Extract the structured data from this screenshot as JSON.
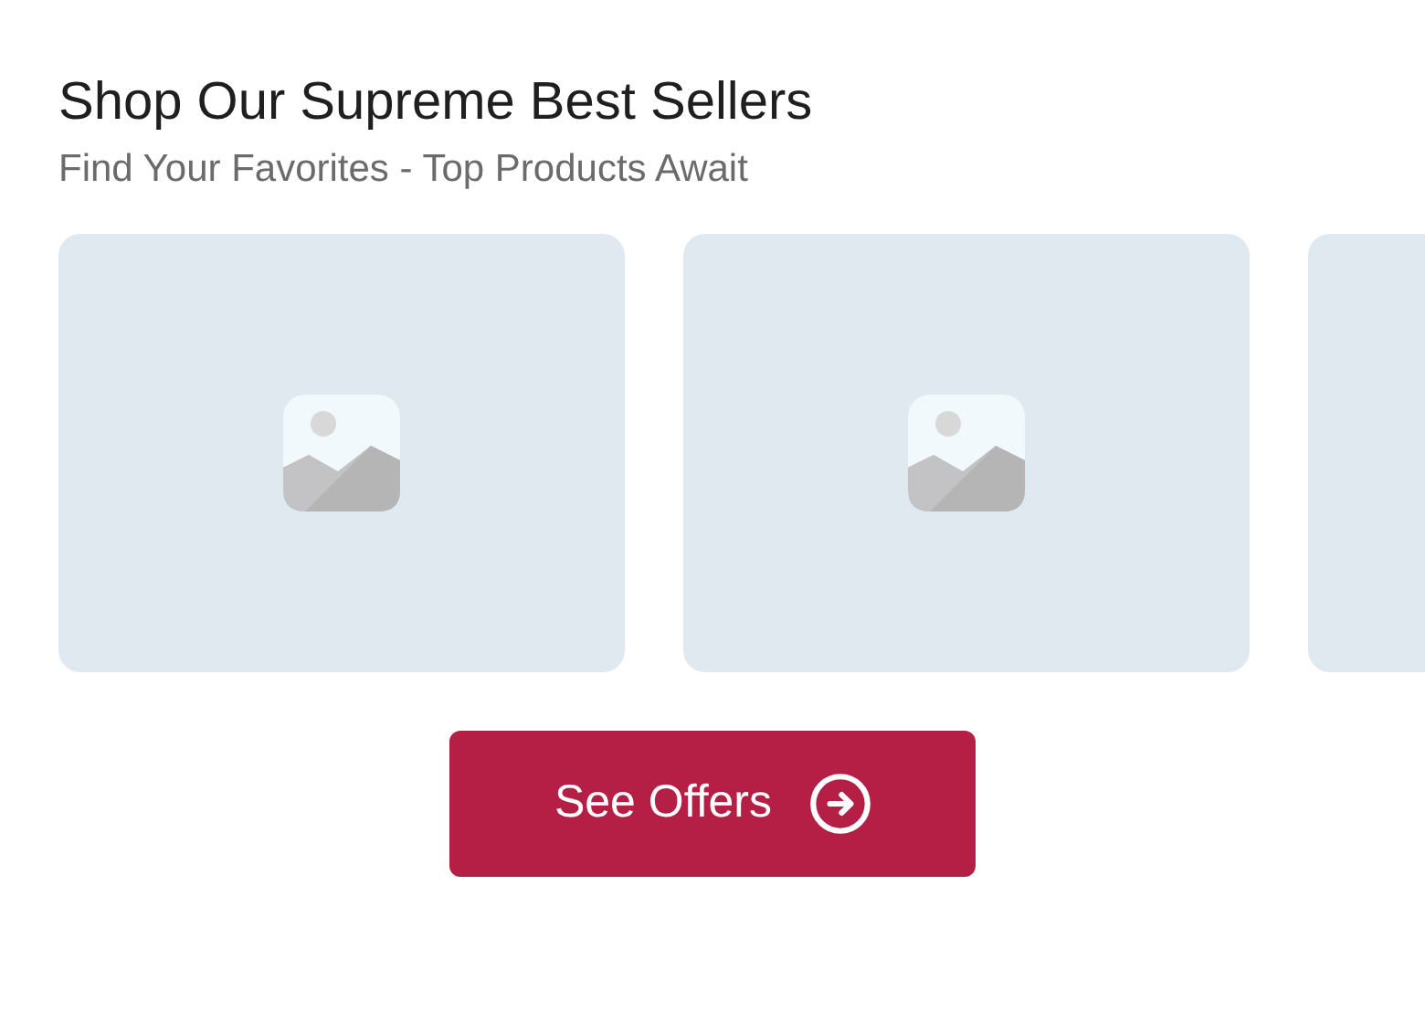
{
  "heading": "Shop Our Supreme Best Sellers",
  "subheading": "Find Your Favorites - Top Products Await",
  "products": [
    {
      "kind": "placeholder"
    },
    {
      "kind": "placeholder"
    },
    {
      "kind": "edge"
    }
  ],
  "button": {
    "label": "See Offers"
  }
}
